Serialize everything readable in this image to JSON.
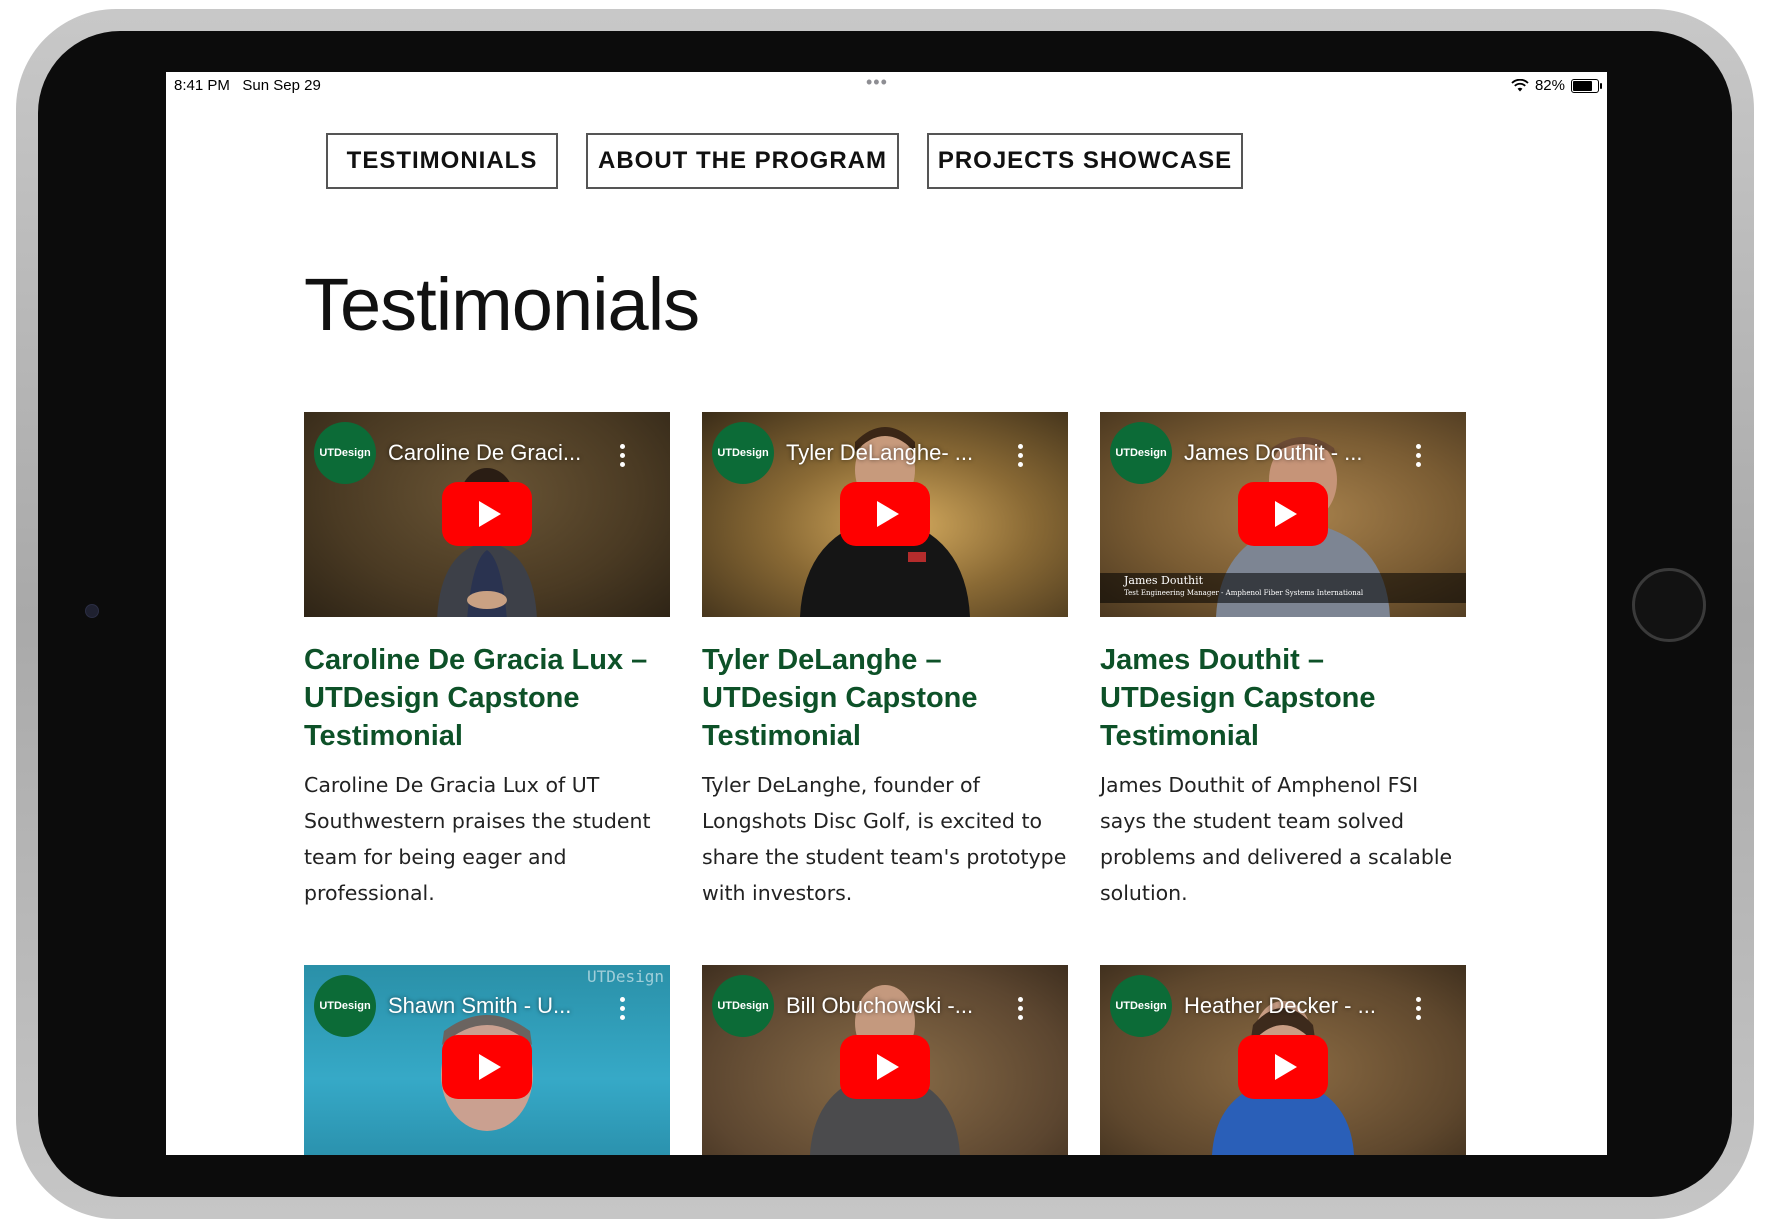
{
  "status_bar": {
    "time": "8:41 PM",
    "date": "Sun Sep 29",
    "multitask_dots": "•••",
    "battery_percent": "82%",
    "battery_level": 0.82,
    "icons": [
      "wifi-icon",
      "battery-icon"
    ]
  },
  "nav": {
    "buttons": [
      {
        "label": "TESTIMONIALS"
      },
      {
        "label": "ABOUT THE PROGRAM"
      },
      {
        "label": "PROJECTS SHOWCASE"
      }
    ]
  },
  "page": {
    "title": "Testimonials"
  },
  "videos": [
    {
      "channel": "UTDesign",
      "video_title": "Caroline De Graci...",
      "title": "Caroline De Gracia Lux – UTDesign Capstone Testimonial",
      "description": "Caroline De Gracia Lux of UT Southwestern praises the student team for being eager and professional."
    },
    {
      "channel": "UTDesign",
      "video_title": "Tyler DeLanghe- ...",
      "title": "Tyler DeLanghe – UTDesign Capstone Testimonial",
      "description": "Tyler DeLanghe, founder of Longshots Disc Golf, is excited to share the student team's prototype with investors."
    },
    {
      "channel": "UTDesign",
      "video_title": "James Douthit - ...",
      "title": "James Douthit – UTDesign Capstone Testimonial",
      "description": "James Douthit of Amphenol FSI says the student team solved problems and delivered a scalable solution.",
      "lower_third_name": "James Douthit",
      "lower_third_role": "Test Engineering Manager - Amphenol Fiber Systems International"
    },
    {
      "channel": "UTDesign",
      "video_title": "Shawn Smith - U...",
      "watermark": "UTDesign"
    },
    {
      "channel": "UTDesign",
      "video_title": "Bill Obuchowski -..."
    },
    {
      "channel": "UTDesign",
      "video_title": "Heather Decker - ..."
    }
  ],
  "colors": {
    "title_green": "#0d5128",
    "channel_green": "#0c6b37",
    "play_red": "#ff0000"
  }
}
